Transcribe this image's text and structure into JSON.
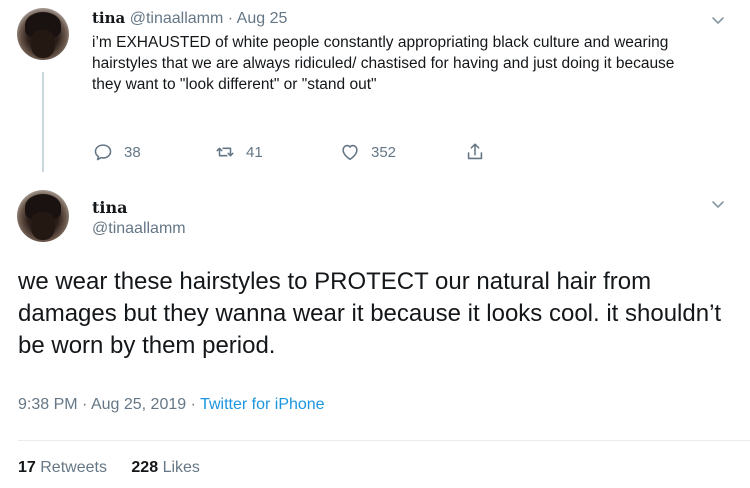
{
  "tweet1": {
    "name": "tina",
    "handle": "@tinaallamm",
    "separator": "·",
    "date": "Aug 25",
    "text": "i’m EXHAUSTED of white people constantly appropriating black culture and wearing hairstyles that we are always ridiculed/ chastised for having and just doing it because they want to \"look different\" or \"stand out\"",
    "replies": "38",
    "retweets": "41",
    "likes": "352"
  },
  "tweet2": {
    "name": "tina",
    "handle": "@tinaallamm",
    "text": "we wear these hairstyles to PROTECT our natural hair from damages but they wanna wear it because it looks cool. it shouldn’t be worn by them period.",
    "time": "9:38 PM",
    "date": "Aug 25, 2019",
    "separator": "·",
    "source": "Twitter for iPhone",
    "retweet_count": "17",
    "retweet_label": "Retweets",
    "like_count": "228",
    "like_label": "Likes"
  },
  "icons": {
    "reply": "reply-icon",
    "retweet": "retweet-icon",
    "like": "heart-icon",
    "share": "share-icon",
    "menu": "chevron-down-icon"
  },
  "colors": {
    "text": "#14171a",
    "muted": "#657786",
    "link": "#1b95e0",
    "thread_line": "#ccd6dd"
  }
}
